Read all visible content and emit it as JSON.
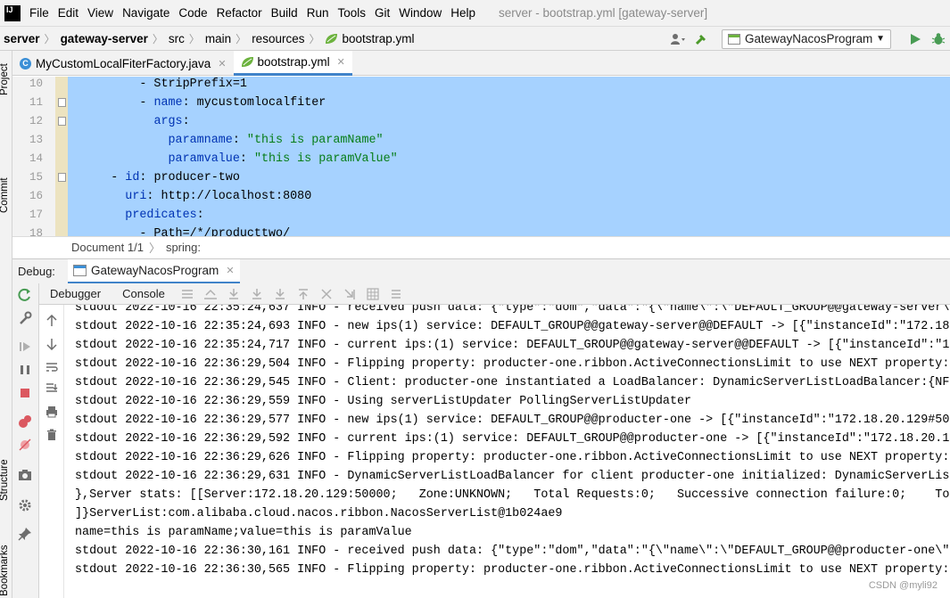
{
  "menubar": {
    "logo": "IJ",
    "items": [
      "File",
      "Edit",
      "View",
      "Navigate",
      "Code",
      "Refactor",
      "Build",
      "Run",
      "Tools",
      "Git",
      "Window",
      "Help"
    ],
    "window_title": "server - bootstrap.yml [gateway-server]"
  },
  "navbar": {
    "breadcrumbs": [
      "server",
      "gateway-server",
      "src",
      "main",
      "resources",
      "bootstrap.yml"
    ],
    "run_config": "GatewayNacosProgram"
  },
  "left_stripe": {
    "labels": [
      "Project",
      "Commit",
      "Structure",
      "Bookmarks"
    ]
  },
  "editor_tabs": [
    {
      "label": "MyCustomLocalFiterFactory.java",
      "icon": "class-icon"
    },
    {
      "label": "bootstrap.yml",
      "icon": "yaml-icon"
    }
  ],
  "editor": {
    "lines": [
      {
        "num": "10",
        "indent": "          ",
        "parts": [
          {
            "t": "- StripPrefix=1",
            "c": ""
          }
        ]
      },
      {
        "num": "11",
        "indent": "          ",
        "parts": [
          {
            "t": "- ",
            "c": ""
          },
          {
            "t": "name",
            "c": "k"
          },
          {
            "t": ": mycustomlocalfiter",
            "c": ""
          }
        ]
      },
      {
        "num": "12",
        "indent": "            ",
        "parts": [
          {
            "t": "args",
            "c": "k"
          },
          {
            "t": ":",
            "c": ""
          }
        ]
      },
      {
        "num": "13",
        "indent": "              ",
        "parts": [
          {
            "t": "paramname",
            "c": "k"
          },
          {
            "t": ": ",
            "c": ""
          },
          {
            "t": "\"this is paramName\"",
            "c": "s"
          }
        ]
      },
      {
        "num": "14",
        "indent": "              ",
        "parts": [
          {
            "t": "paramvalue",
            "c": "k"
          },
          {
            "t": ": ",
            "c": ""
          },
          {
            "t": "\"this is paramValue\"",
            "c": "s"
          }
        ]
      },
      {
        "num": "15",
        "indent": "      ",
        "parts": [
          {
            "t": "- ",
            "c": ""
          },
          {
            "t": "id",
            "c": "k"
          },
          {
            "t": ": producer-two",
            "c": ""
          }
        ]
      },
      {
        "num": "16",
        "indent": "        ",
        "parts": [
          {
            "t": "uri",
            "c": "k"
          },
          {
            "t": ": http://localhost:8080",
            "c": ""
          }
        ]
      },
      {
        "num": "17",
        "indent": "        ",
        "parts": [
          {
            "t": "predicates",
            "c": "k"
          },
          {
            "t": ":",
            "c": ""
          }
        ]
      },
      {
        "num": "18",
        "indent": "          ",
        "parts": [
          {
            "t": "- Path=/*/producttwo/",
            "c": ""
          }
        ]
      }
    ]
  },
  "doc_crumb": {
    "document": "Document 1/1",
    "path": "spring:"
  },
  "debug": {
    "label": "Debug:",
    "session_tab": "GatewayNacosProgram",
    "sub_tabs": [
      "Debugger",
      "Console"
    ]
  },
  "console": {
    "lines": [
      "stdout 2022-10-16 22:35:24,637 INFO - received push data: {\"type\":\"dom\",\"data\":\"{\\\"name\\\":\\\"DEFAULT_GROUP@@gateway-server\\\",",
      "stdout 2022-10-16 22:35:24,693 INFO - new ips(1) service: DEFAULT_GROUP@@gateway-server@@DEFAULT -> [{\"instanceId\":\"172.18.",
      "stdout 2022-10-16 22:35:24,717 INFO - current ips:(1) service: DEFAULT_GROUP@@gateway-server@@DEFAULT -> [{\"instanceId\":\"17",
      "stdout 2022-10-16 22:36:29,504 INFO - Flipping property: producter-one.ribbon.ActiveConnectionsLimit to use NEXT property:",
      "stdout 2022-10-16 22:36:29,545 INFO - Client: producter-one instantiated a LoadBalancer: DynamicServerListLoadBalancer:{NFL",
      "stdout 2022-10-16 22:36:29,559 INFO - Using serverListUpdater PollingServerListUpdater",
      "stdout 2022-10-16 22:36:29,577 INFO - new ips(1) service: DEFAULT_GROUP@@producter-one -> [{\"instanceId\":\"172.18.20.129#500",
      "stdout 2022-10-16 22:36:29,592 INFO - current ips:(1) service: DEFAULT_GROUP@@producter-one -> [{\"instanceId\":\"172.18.20.12",
      "stdout 2022-10-16 22:36:29,626 INFO - Flipping property: producter-one.ribbon.ActiveConnectionsLimit to use NEXT property:",
      "stdout 2022-10-16 22:36:29,631 INFO - DynamicServerListLoadBalancer for client producter-one initialized: DynamicServerList",
      "},Server stats: [[Server:172.18.20.129:50000;   Zone:UNKNOWN;   Total Requests:0;   Successive connection failure:0;    Tot",
      "]}ServerList:com.alibaba.cloud.nacos.ribbon.NacosServerList@1b024ae9",
      "name=this is paramName;value=this is paramValue",
      "stdout 2022-10-16 22:36:30,161 INFO - received push data: {\"type\":\"dom\",\"data\":\"{\\\"name\\\":\\\"DEFAULT_GROUP@@producter-one\\\",",
      "stdout 2022-10-16 22:36:30,565 INFO - Flipping property: producter-one.ribbon.ActiveConnectionsLimit to use NEXT property:"
    ]
  },
  "watermark": "CSDN @myli92",
  "colors": {
    "selection": "#a6d2ff",
    "keyword": "#0033b3",
    "string": "#067d17",
    "accent": "#4083c9"
  }
}
